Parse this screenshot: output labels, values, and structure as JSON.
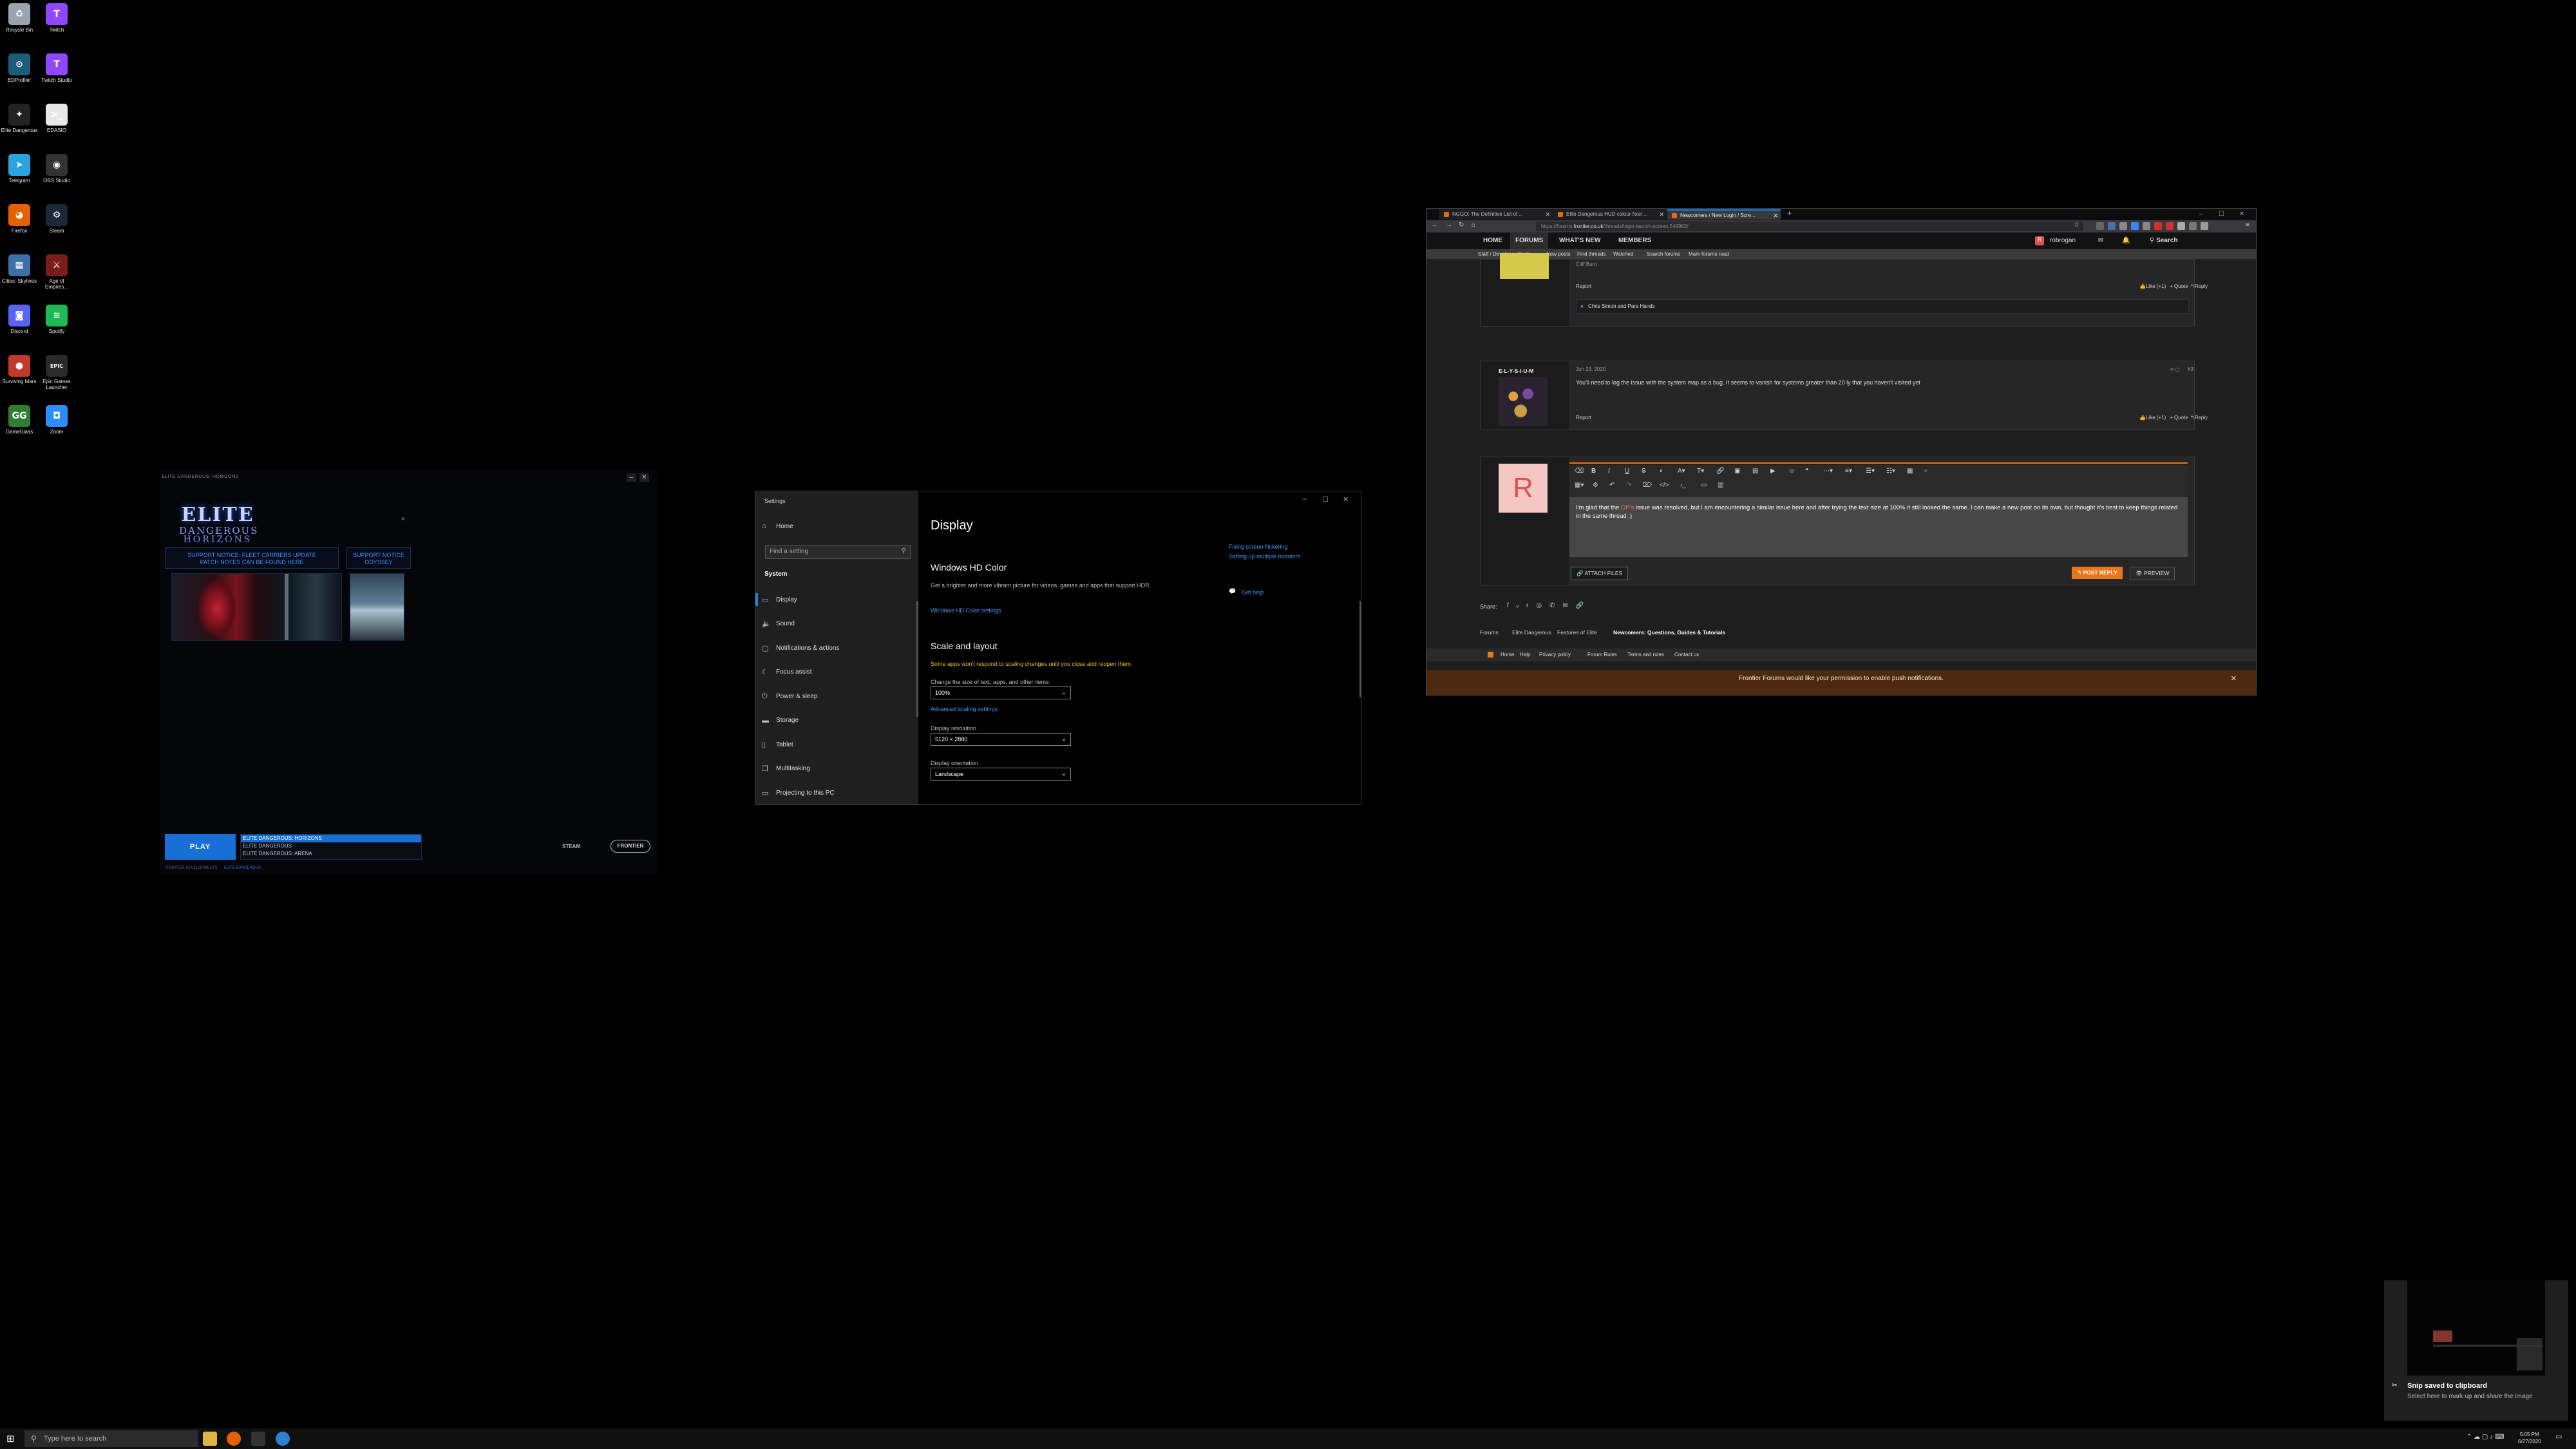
{
  "desktop_icons": [
    {
      "label": "Recycle Bin",
      "icon": "recycle-bin-icon",
      "color": "#9aa4b0",
      "glyph": "♻"
    },
    {
      "label": "Twitch",
      "icon": "twitch-icon",
      "color": "#9146ff",
      "glyph": "T"
    },
    {
      "label": "EDProfiler",
      "icon": "edprofiler-icon",
      "color": "#1a5d7a",
      "glyph": "⊙"
    },
    {
      "label": "Twitch Studio",
      "icon": "twitch-studio-icon",
      "color": "#9146ff",
      "glyph": "T"
    },
    {
      "label": "Elite Dangerous",
      "icon": "elite-dangerous-icon",
      "color": "#222222",
      "glyph": "✦"
    },
    {
      "label": "EDASIO",
      "icon": "edasio-icon",
      "color": "#e8e8e8",
      "glyph": ">_"
    },
    {
      "label": "Telegram",
      "icon": "telegram-icon",
      "color": "#2aa3de",
      "glyph": "➤"
    },
    {
      "label": "OBS Studio",
      "icon": "obs-studio-icon",
      "color": "#333333",
      "glyph": "◉"
    },
    {
      "label": "Firefox",
      "icon": "firefox-icon",
      "color": "#e66000",
      "glyph": "◕"
    },
    {
      "label": "Steam",
      "icon": "steam-icon",
      "color": "#1b2838",
      "glyph": "⚙"
    },
    {
      "label": "Cities: Skylines",
      "icon": "cities-skylines-icon",
      "color": "#3d6fa8",
      "glyph": "▦"
    },
    {
      "label": "Age of Empires...",
      "icon": "age-of-empires-icon",
      "color": "#7a1c1c",
      "glyph": "⚔"
    },
    {
      "label": "Discord",
      "icon": "discord-icon",
      "color": "#5865f2",
      "glyph": "◙"
    },
    {
      "label": "Spotify",
      "icon": "spotify-icon",
      "color": "#1db954",
      "glyph": "≋"
    },
    {
      "label": "Surviving Mars",
      "icon": "surviving-mars-icon",
      "color": "#c0392b",
      "glyph": "●"
    },
    {
      "label": "Epic Games Launcher",
      "icon": "epic-games-icon",
      "color": "#2a2a2a",
      "glyph": "EPIC"
    },
    {
      "label": "GameGlass",
      "icon": "gameglass-icon",
      "color": "#2e7d32",
      "glyph": "GG"
    },
    {
      "label": "Zoom",
      "icon": "zoom-icon",
      "color": "#2d8cff",
      "glyph": "◘"
    }
  ],
  "launcher": {
    "title": "ELITE DANGEROUS: HORIZONS",
    "logo_line1": "ELITE",
    "logo_line2": "DANGEROUS",
    "logo_line3": "HORIZONS",
    "notice1_title": "SUPPORT NOTICE: FLEET CARRIERS UPDATE",
    "notice1_sub": "PATCH NOTES CAN BE FOUND",
    "notice1_link": "HERE",
    "notice2_title": "SUPPORT NOTICE",
    "notice2_sub": "ODYSSEY",
    "play": "PLAY",
    "games": [
      "ELITE DANGEROUS: HORIZONS",
      "ELITE DANGEROUS",
      "ELITE DANGEROUS: ARENA"
    ],
    "footer_left": "FRONTIER DEVELOPMENTS",
    "footer_right": "ELITE DANGEROUS",
    "steam": "STEAM",
    "frontier": "FRONTIER"
  },
  "settings": {
    "window_title": "Settings",
    "home": "Home",
    "search_placeholder": "Find a setting",
    "section": "System",
    "nav": [
      {
        "label": "Display",
        "icon": "display-icon",
        "glyph": "▭"
      },
      {
        "label": "Sound",
        "icon": "sound-icon",
        "glyph": "🔈"
      },
      {
        "label": "Notifications & actions",
        "icon": "notifications-icon",
        "glyph": "▢"
      },
      {
        "label": "Focus assist",
        "icon": "focus-assist-icon",
        "glyph": "☾"
      },
      {
        "label": "Power & sleep",
        "icon": "power-icon",
        "glyph": "⏻"
      },
      {
        "label": "Storage",
        "icon": "storage-icon",
        "glyph": "▬"
      },
      {
        "label": "Tablet",
        "icon": "tablet-icon",
        "glyph": "▯"
      },
      {
        "label": "Multitasking",
        "icon": "multitasking-icon",
        "glyph": "❐"
      },
      {
        "label": "Projecting to this PC",
        "icon": "projecting-icon",
        "glyph": "▭"
      }
    ],
    "page_title": "Display",
    "hdr_title": "Windows HD Color",
    "hdr_desc": "Get a brighter and more vibrant picture for videos, games and apps that support HDR.",
    "hdr_link": "Windows HD Color settings",
    "scale_title": "Scale and layout",
    "scale_warning": "Some apps won't respond to scaling changes until you close and reopen them.",
    "scale_label": "Change the size of text, apps, and other items",
    "scale_value": "100%",
    "advanced_link": "Advanced scaling settings",
    "resolution_label": "Display resolution",
    "resolution_value": "5120 × 2880",
    "orientation_label": "Display orientation",
    "orientation_value": "Landscape",
    "right_link1": "Fixing screen flickering",
    "right_link2": "Setting up multiple monitors",
    "get_help": "Get help"
  },
  "firefox": {
    "tabs": [
      "NGGO: The Definitive List of ...",
      "Elite Dangerous HUD colour fixer ...",
      "Newcomers / New Login / Scre..."
    ],
    "url_prefix": "https://forums.",
    "url_domain": "frontier.co.uk",
    "url_rest": "/threads/login-launch-screen.549982/",
    "nav": [
      "HOME",
      "FORUMS",
      "WHAT'S NEW",
      "MEMBERS"
    ],
    "user": "robrogan",
    "search": "Search",
    "subnav": [
      "Staff / Developer Posts",
      "New posts",
      "Find threads",
      "Watched",
      "Search forums",
      "Mark forums read"
    ],
    "post1_name": "Cliff Burri",
    "post1_report": "Report",
    "post1_like": "Like (+1)",
    "post1_quote": "+ Quote",
    "post1_reply": "Reply",
    "post1_reactions": "Chris Simon and Para Hands",
    "post2_user": "E-L-Y-S-I-U-M",
    "post2_date": "Jun 23, 2020",
    "post2_num": "#3",
    "post2_text": "You'll need to log the issue with the system map as a bug. It seems to vanish for systems greater than 20 ly that you haven't visited yet",
    "post2_report": "Report",
    "post2_like": "Like (+1)",
    "post2_quote": "+ Quote",
    "post2_reply": "Reply",
    "avatar_letter": "R",
    "reply_text_pre": "I'm glad that the ",
    "reply_text_hl": "OP's",
    "reply_text_post": " issue was resolved, but I am encountering a similar issue here and after trying the text size at 100% it still looked the same. I can make a new post on its own, but thought it's best to keep things related in the same thread :)",
    "attach": "ATTACH FILES",
    "post_reply": "POST REPLY",
    "preview": "PREVIEW",
    "share": "Share:",
    "breadcrumbs": [
      "Forums",
      "Elite Dangerous",
      "Features of Elite",
      "Newcomers: Questions, Guides & Tutorials"
    ],
    "footer": [
      "Home",
      "Help",
      "Privacy policy",
      "Forum Rules",
      "Terms and rules",
      "Contact us"
    ],
    "push": "Frontier Forums would like your permission to enable push notifications."
  },
  "snip": {
    "title": "Snip saved to clipboard",
    "body": "Select here to mark up and share the image"
  },
  "taskbar": {
    "search_placeholder": "Type here to search",
    "time": "5:05 PM",
    "date": "6/27/2020"
  }
}
